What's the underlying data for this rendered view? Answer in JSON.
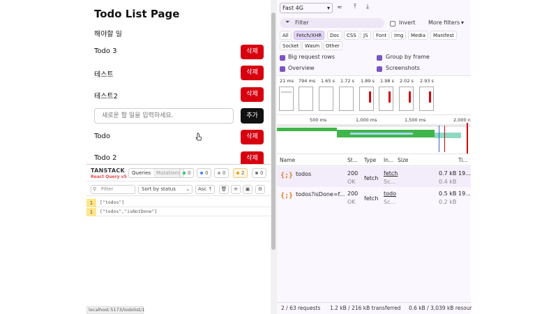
{
  "app": {
    "title": "Todo List Page",
    "subtitle": "해야할 일",
    "todos": [
      {
        "label": "Todo 3",
        "action": "삭제"
      },
      {
        "label": "테스트",
        "action": "삭제"
      },
      {
        "label": "테스트2",
        "action": "삭제"
      },
      {
        "label": "Todo",
        "action": "삭제"
      },
      {
        "label": "Todo 2",
        "action": "삭제"
      }
    ],
    "input_placeholder": "새로운 할 일을 입력하세요.",
    "add_label": "추가"
  },
  "status_url": "localhost:5173/todolist/1",
  "react_query": {
    "logo_line1": "TANSTACK",
    "logo_line2": "React Query v5",
    "tabs": [
      "Queries",
      "Mutations"
    ],
    "badges": [
      {
        "count": "0",
        "color": "#22c55e"
      },
      {
        "count": "0",
        "color": "#3b82f6"
      },
      {
        "count": "0",
        "color": "#9ca3af"
      },
      {
        "count": "2",
        "color": "#f59e0b"
      },
      {
        "count": "0",
        "color": "#6b7280"
      }
    ],
    "filter_placeholder": "Filter",
    "sort_label": "Sort by status",
    "order_label": "Asc ↑",
    "queries": [
      {
        "count": "1",
        "key": "[\"todos\"]"
      },
      {
        "count": "1",
        "key": "[\"todos\",\"isNotDone\"]"
      }
    ]
  },
  "devtools": {
    "throttle": "Fast 4G",
    "filter_placeholder": "Filter",
    "invert_label": "Invert",
    "more_filters": "More filters",
    "types": [
      "All",
      "Fetch/XHR",
      "Doc",
      "CSS",
      "JS",
      "Font",
      "Img",
      "Media",
      "Manifest",
      "Socket",
      "Wasm",
      "Other"
    ],
    "options": {
      "big_rows": "Big request rows",
      "group_frame": "Group by frame",
      "overview": "Overview",
      "screenshots": "Screenshots"
    },
    "frame_times": [
      "21 ms",
      "794 ms",
      "1.65 s",
      "1.72 s",
      "1.89 s",
      "1.98 s",
      "2.02 s",
      "2.93 s"
    ],
    "timeline_labels": [
      "500 ms",
      "1,000 ms",
      "1,500 ms",
      "2,000 n"
    ],
    "columns": [
      "Name",
      "St...",
      "Type",
      "In...",
      "Size",
      "Ti..."
    ],
    "requests": [
      {
        "name": "todos",
        "status": "200",
        "status_text": "OK",
        "type": "fetch",
        "initiator": "fetch",
        "initiator_sub": "Sc...",
        "size": "0.7 kB",
        "size_sub": "0.4 kB",
        "time": "19..."
      },
      {
        "name": "todos?isDone=f...",
        "status": "200",
        "status_text": "OK",
        "type": "fetch",
        "initiator": "todo",
        "initiator_sub": "Sc...",
        "size": "0.5 kB",
        "size_sub": "0.2 kB",
        "time": "19..."
      }
    ],
    "footer": {
      "requests": "2 / 63 requests",
      "transferred": "1.2 kB / 216 kB transferred",
      "resources": "0.6 kB / 3,039 kB resour"
    }
  }
}
